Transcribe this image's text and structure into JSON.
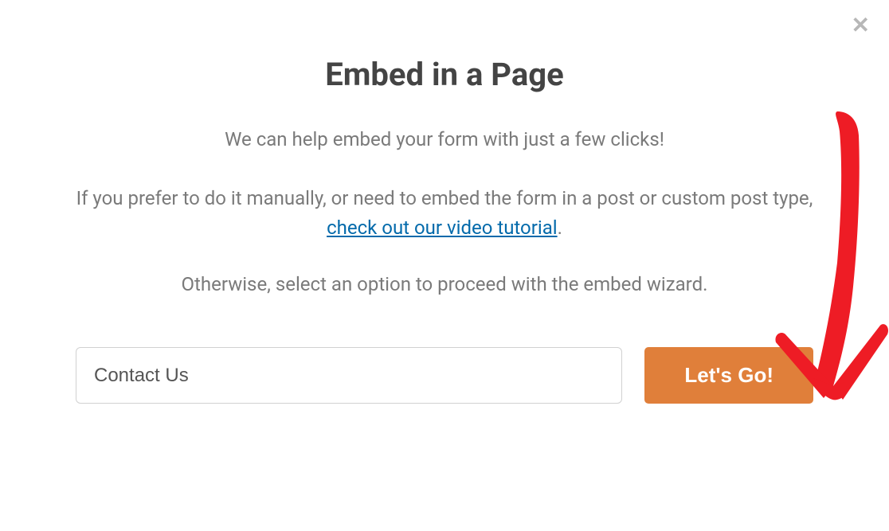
{
  "modal": {
    "title": "Embed in a Page",
    "subtitle": "We can help embed your form with just a few clicks!",
    "paragraph2_pre": "If you prefer to do it manually, or need to embed the form in a post or custom post type, ",
    "link_text": "check out our video tutorial",
    "paragraph2_post": ".",
    "paragraph3": "Otherwise, select an option to proceed with the embed wizard.",
    "input_value": "Contact Us",
    "button_label": "Let's Go!"
  }
}
